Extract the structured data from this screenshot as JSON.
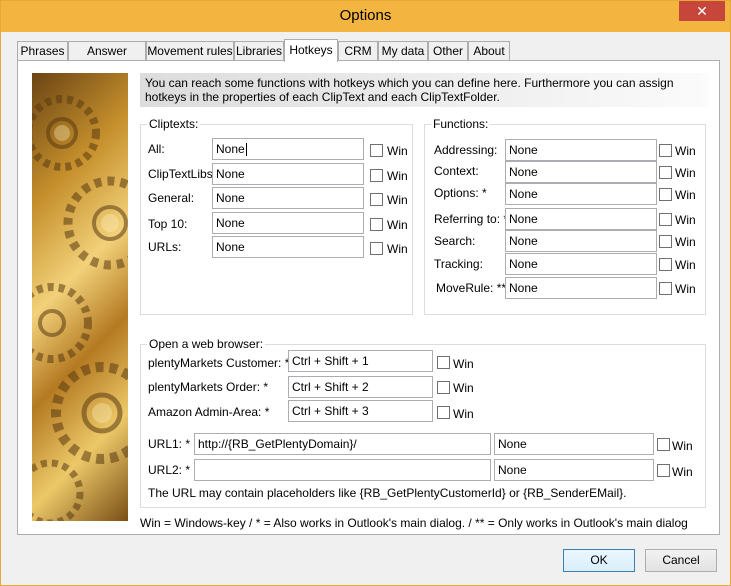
{
  "window": {
    "title": "Options",
    "close_glyph": "✕"
  },
  "tabs": [
    {
      "label": "Phrases",
      "active": false
    },
    {
      "label": "Answer details",
      "active": false
    },
    {
      "label": "Movement rules",
      "active": false
    },
    {
      "label": "Libraries",
      "active": false
    },
    {
      "label": "Hotkeys",
      "active": true
    },
    {
      "label": "CRM",
      "active": false
    },
    {
      "label": "My data",
      "active": false
    },
    {
      "label": "Other",
      "active": false
    },
    {
      "label": "About",
      "active": false
    }
  ],
  "info_text": "You can reach some functions with hotkeys which you can define here. Furthermore you can assign hotkeys in the properties of each ClipText and each ClipTextFolder.",
  "cliptexts": {
    "title": "Cliptexts:",
    "rows": [
      {
        "label": "All:",
        "value": "None",
        "win": "Win"
      },
      {
        "label": "ClipTextLibs:",
        "value": "None",
        "win": "Win"
      },
      {
        "label": "General:",
        "value": "None",
        "win": "Win"
      },
      {
        "label": "Top 10:",
        "value": "None",
        "win": "Win"
      },
      {
        "label": "URLs:",
        "value": "None",
        "win": "Win"
      }
    ]
  },
  "functions": {
    "title": "Functions:",
    "rows": [
      {
        "label": "Addressing:",
        "value": "None",
        "win": "Win"
      },
      {
        "label": "Context:",
        "value": "None",
        "win": "Win"
      },
      {
        "label": "Options: *",
        "value": "None",
        "win": "Win"
      },
      {
        "label": "Referring to: *",
        "value": "None",
        "win": "Win"
      },
      {
        "label": "Search:",
        "value": "None",
        "win": "Win"
      },
      {
        "label": "Tracking:",
        "value": "None",
        "win": "Win"
      },
      {
        "label": "MoveRule: **",
        "value": "None",
        "win": "Win"
      }
    ]
  },
  "browser": {
    "title": "Open a web browser:",
    "rows": [
      {
        "label": "plentyMarkets Customer: *",
        "value": "Ctrl + Shift + 1",
        "win": "Win"
      },
      {
        "label": "plentyMarkets Order: *",
        "value": "Ctrl + Shift + 2",
        "win": "Win"
      },
      {
        "label": "Amazon Admin-Area: *",
        "value": "Ctrl + Shift + 3",
        "win": "Win"
      }
    ],
    "urls": [
      {
        "label": "URL1: *",
        "url": "http://{RB_GetPlentyDomain}/",
        "hotkey": "None",
        "win": "Win"
      },
      {
        "label": "URL2: *",
        "url": "",
        "hotkey": "None",
        "win": "Win"
      }
    ],
    "note": "The URL may contain placeholders like {RB_GetPlentyCustomerId} or {RB_SenderEMail}."
  },
  "footnote": "Win = Windows-key / * = Also works in Outlook's main dialog. / ** = Only works in Outlook's main dialog",
  "buttons": {
    "ok": "OK",
    "cancel": "Cancel"
  },
  "colors": {
    "titlebar": "#f3b440",
    "close": "#c7463c",
    "primary_border": "#3c7fb1"
  }
}
